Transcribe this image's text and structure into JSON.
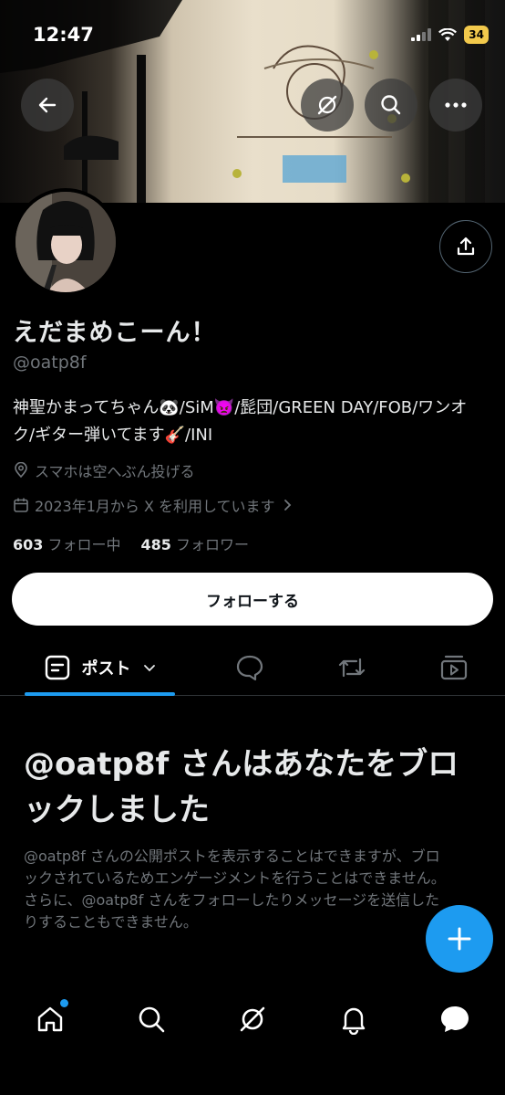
{
  "status_bar": {
    "time": "12:47",
    "battery": "34"
  },
  "profile": {
    "name": "えだまめこーん！",
    "handle": "@oatp8f",
    "bio": "神聖かまってちゃん🐼/SiM👿/髭団/GREEN DAY/FOB/ワンオク/ギター弾いてます🎸/INI",
    "location": "スマホは空へぶん投げる",
    "joined": "2023年1月から X を利用しています",
    "following_count": "603",
    "following_label": "フォロー中",
    "followers_count": "485",
    "followers_label": "フォロワー"
  },
  "actions": {
    "follow_label": "フォローする"
  },
  "tabs": {
    "posts_label": "ポスト"
  },
  "blocked": {
    "title": "@oatp8f さんはあなたをブロックしました",
    "body": "@oatp8f さんの公開ポストを表示することはできますが、ブロックされているためエンゲージメントを行うことはできません。さらに、@oatp8f さんをフォローしたりメッセージを送信したりすることもできません。"
  },
  "colors": {
    "accent": "#1d9bf0",
    "muted": "#71767b",
    "text": "#e7e9ea",
    "battery": "#f2c94c"
  },
  "icons": [
    "back-arrow-icon",
    "grok-icon",
    "search-icon",
    "more-icon",
    "share-icon",
    "location-icon",
    "calendar-icon",
    "chevron-right-icon",
    "posts-icon",
    "chevron-down-icon",
    "reply-icon",
    "repost-icon",
    "media-icon",
    "plus-icon",
    "home-icon",
    "grok-nav-icon",
    "bell-icon",
    "messages-icon"
  ]
}
